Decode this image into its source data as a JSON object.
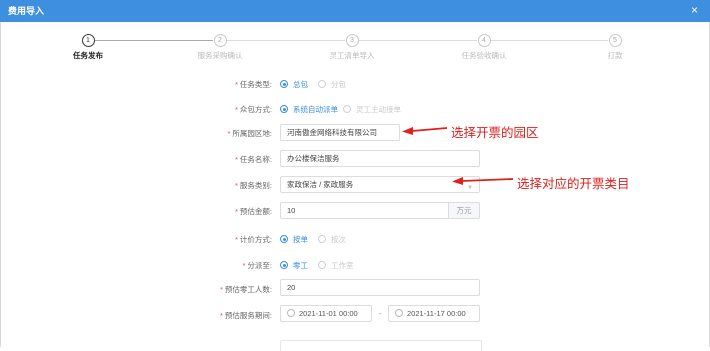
{
  "window": {
    "title": "费用导入",
    "close_glyph": "×"
  },
  "steps": [
    {
      "num": "1",
      "label": "任务发布",
      "active": true
    },
    {
      "num": "2",
      "label": "服务采购确认",
      "active": false
    },
    {
      "num": "3",
      "label": "灵工清单导入",
      "active": false
    },
    {
      "num": "4",
      "label": "任务验收确认",
      "active": false
    },
    {
      "num": "5",
      "label": "打款",
      "active": false
    }
  ],
  "form": {
    "task_type": {
      "label": "任务类型:",
      "options": [
        "总包",
        "分包"
      ],
      "selected": "总包"
    },
    "crowd_mode": {
      "label": "众包方式:",
      "options": [
        "系统自动派单",
        "灵工主动接单"
      ],
      "selected": "系统自动派单"
    },
    "park": {
      "label": "所属园区地:",
      "value": "河南傲金网络科技有限公司"
    },
    "task_name": {
      "label": "任务名称:",
      "value": "办公楼保洁服务"
    },
    "service_category": {
      "label": "服务类别:",
      "value": "家政保洁 / 家政服务"
    },
    "budget": {
      "label": "预估金额:",
      "value": "10",
      "unit": "万元"
    },
    "pricing": {
      "label": "计价方式:",
      "options": [
        "按单",
        "按次"
      ],
      "selected": "按单"
    },
    "dispatch_to": {
      "label": "分派至:",
      "options": [
        "零工",
        "工作室"
      ],
      "selected": "零工"
    },
    "worker_count": {
      "label": "预估零工人数:",
      "value": "20"
    },
    "service_period": {
      "label": "预估服务期间:",
      "start": "2021-11-01 00:00",
      "end": "2021-11-17 00:00",
      "separator": "-"
    }
  },
  "annotations": {
    "park_note": "选择开票的园区",
    "category_note": "选择对应的开票类目",
    "arrow_color": "#e0201c"
  },
  "colors": {
    "header": "#3f8fe0",
    "accent": "#3a8ee6",
    "required": "#e94b43"
  }
}
